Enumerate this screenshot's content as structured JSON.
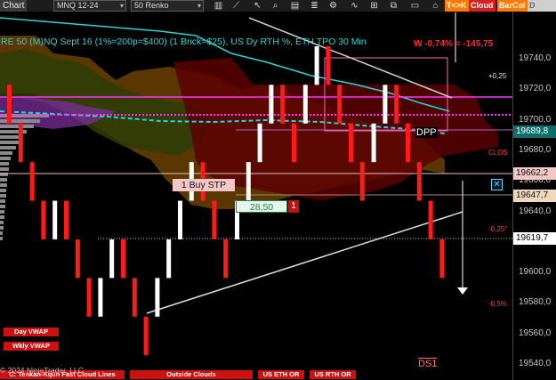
{
  "toolbar": {
    "chart_tab": "Chart",
    "instrument": "MNQ 12-24",
    "bar_type": "50 Renko",
    "icons": [
      "bar-style-icon",
      "draw-line-icon",
      "zoom-icon",
      "data-box-icon",
      "properties-icon",
      "strategies-icon",
      "indicators-icon",
      "grid-icon",
      "multi-window-icon",
      "chart-trader-icon"
    ],
    "buttons": {
      "tick_to_price": "T<>K",
      "cloud": "Cloud",
      "bar_color": "BarCol",
      "d_vwap": "D VWAP"
    }
  },
  "chart": {
    "title": "RE 50 (M)NQ Sept 16 (1%=200p=$400) (1 Brick=$25), US Dy RTH %, ETH TPO 30 Min",
    "w_stat": "W -0,74% = -145,75",
    "pct_labels": {
      "plus_025": "+0,25",
      "minus_025": "-0,25°",
      "minus_05": "-0,5%",
      "close": "CLOS"
    },
    "order_label": "1 Buy STP",
    "order_qty": "28,50",
    "order_num": "1",
    "dpp": "DPP",
    "ds1": "DS1",
    "copyright": "© 2024 NinjaTrader, LLC",
    "legend": {
      "day_vwap": "Day VWAP",
      "wkly_vwap": "Wkly VWAP",
      "tenkan": "C: Tenkan-Kijun Fast Cloud Lines",
      "outside_clouds": "Outside Clouds",
      "us_eth_or": "US ETH OR",
      "us_rth_or": "US RTH OR"
    },
    "colors": {
      "bull": "#ffffff",
      "bear": "#ff1a1a",
      "cloud_orange": "#7a4a00",
      "cloud_red": "#5a0000",
      "vwap": "#2ad4d4",
      "magenta": "#ff33ff",
      "axis_current": "#ffffff",
      "buy_stop": "#f3c7c7",
      "target": "#f5dcc0"
    }
  },
  "price_axis": {
    "ticks": [
      "19740,0",
      "19720,0",
      "19700,0",
      "19680,0",
      "19660,0",
      "19640,0",
      "19620,0",
      "19600,0",
      "19580,0",
      "19560,0",
      "19540,0"
    ],
    "tags": {
      "vwap": "19689,8",
      "buy_stop": "19662,2",
      "target": "19647,7",
      "last": "19619,7"
    }
  },
  "chart_data": {
    "type": "renko",
    "brick_size": 25,
    "ylim": [
      19535,
      19755
    ],
    "bricks": [
      [
        "bear",
        19726,
        19701
      ],
      [
        "bear",
        19701,
        19676
      ],
      [
        "bear",
        19676,
        19651
      ],
      [
        "bear",
        19651,
        19626
      ],
      [
        "bull",
        19651,
        19626
      ],
      [
        "bear",
        19651,
        19626
      ],
      [
        "bear",
        19626,
        19601
      ],
      [
        "bear",
        19601,
        19576
      ],
      [
        "bull",
        19601,
        19576
      ],
      [
        "bull",
        19626,
        19601
      ],
      [
        "bear",
        19626,
        19601
      ],
      [
        "bear",
        19601,
        19576
      ],
      [
        "bear",
        19576,
        19551
      ],
      [
        "bull",
        19601,
        19576
      ],
      [
        "bull",
        19626,
        19601
      ],
      [
        "bull",
        19651,
        19626
      ],
      [
        "bull",
        19676,
        19651
      ],
      [
        "bear",
        19676,
        19651
      ],
      [
        "bear",
        19651,
        19626
      ],
      [
        "bear",
        19626,
        19601
      ],
      [
        "bull",
        19651,
        19626
      ],
      [
        "bull",
        19676,
        19651
      ],
      [
        "bull",
        19701,
        19676
      ],
      [
        "bull",
        19726,
        19701
      ],
      [
        "bear",
        19726,
        19701
      ],
      [
        "bear",
        19701,
        19676
      ],
      [
        "bull",
        19726,
        19701
      ],
      [
        "bull",
        19751,
        19726
      ],
      [
        "bear",
        19751,
        19726
      ],
      [
        "bear",
        19726,
        19701
      ],
      [
        "bear",
        19701,
        19676
      ],
      [
        "bear",
        19676,
        19651
      ],
      [
        "bull",
        19701,
        19676
      ],
      [
        "bull",
        19726,
        19701
      ],
      [
        "bear",
        19726,
        19701
      ],
      [
        "bear",
        19701,
        19676
      ],
      [
        "bear",
        19676,
        19651
      ],
      [
        "bear",
        19651,
        19626
      ],
      [
        "bear",
        19626,
        19601
      ]
    ]
  }
}
